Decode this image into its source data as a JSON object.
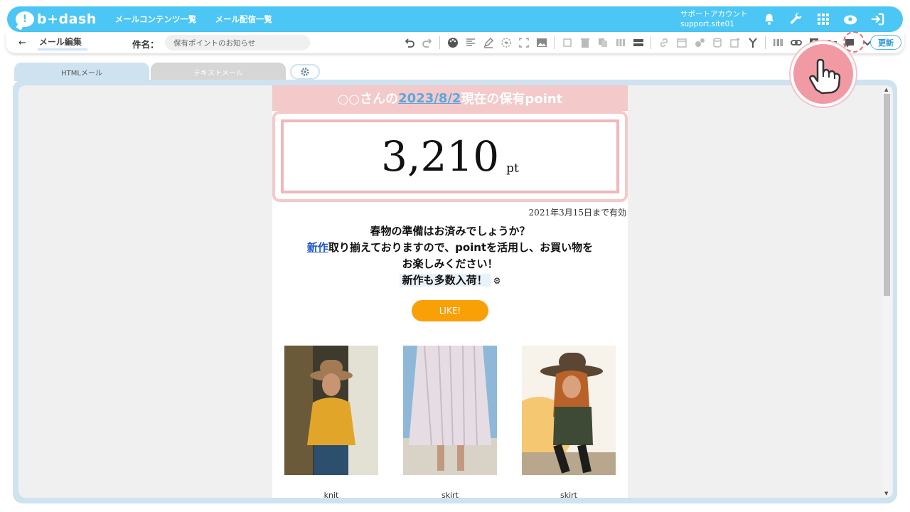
{
  "topbar": {
    "logo_text": "b+dash",
    "nav": [
      "メールコンテンツ一覧",
      "メール配信一覧"
    ],
    "account_name": "サポートアカウント",
    "account_id": "support.site01",
    "icons": [
      "bell-icon",
      "wrench-icon",
      "grid-icon",
      "cloud-icon",
      "logout-icon"
    ]
  },
  "toolbar": {
    "back_label": "メール編集",
    "subject_label": "件名：",
    "subject_value": "保有ポイントのお知らせ",
    "update_label": "更新"
  },
  "tabs": {
    "html": "HTMLメール",
    "text": "テキストメール"
  },
  "email": {
    "header_prefix": "○○さんの",
    "header_date": "2023/8/2",
    "header_suffix": "現在の保有point",
    "point_value": "3,210",
    "point_unit": "pt",
    "valid_until": "2021年3月15日まで有効",
    "message_line1": "春物の準備はお済みでしょうか？",
    "message_link": "新作",
    "message_line2": "取り揃えておりますので、pointを活用し、お買い物を",
    "message_line3": "お楽しみください！",
    "message_line4": "新作も多数入荷！",
    "like_label": "LIKE!",
    "products": [
      {
        "label": "knit"
      },
      {
        "label": "skirt"
      },
      {
        "label": "skirt"
      }
    ]
  },
  "colors": {
    "brand": "#4cc6f4",
    "header_pink": "#f4c9c9",
    "like_orange": "#f9a007",
    "badge_pink": "#f29aa3"
  }
}
